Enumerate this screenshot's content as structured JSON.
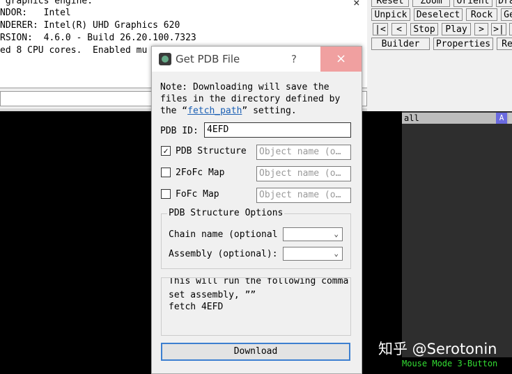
{
  "console": {
    "lines": [
      " graphics engine:",
      "NDOR:   Intel",
      "NDERER: Intel(R) UHD Graphics 620",
      "RSION:  4.6.0 - Build 26.20.100.7323",
      "ed 8 CPU cores.  Enabled mu"
    ],
    "close_glyph": "×"
  },
  "button_panel": {
    "row0": [
      "Reset",
      "Zoom",
      "Orient",
      "Dra"
    ],
    "row1": [
      "Unpick",
      "Deselect",
      "Rock",
      "Ge"
    ],
    "row2": [
      "|<",
      "<",
      "Stop",
      "Play",
      ">",
      ">|",
      "M"
    ],
    "row3": [
      "Builder",
      "Properties",
      "Re"
    ]
  },
  "object_panel": {
    "name": "all",
    "badge": "A",
    "mouse_mode": "Mouse Mode 3-Button"
  },
  "watermark": "知乎 @Serotonin",
  "dialog": {
    "title": "Get PDB File",
    "help": "?",
    "close": "×",
    "note_line1": "Note: Downloading will save the",
    "note_line2": "files in the directory defined by",
    "note_line3_pre": "the “",
    "note_link": "fetch_path",
    "note_line3_post": "” setting.",
    "pdb_id_label": "PDB ID:",
    "pdb_id_value": "4EFD",
    "rows": [
      {
        "label": "PDB Structure",
        "checked": true,
        "check_glyph": "✓",
        "placeholder": "Object name (o…"
      },
      {
        "label": "2FoFc Map",
        "checked": false,
        "check_glyph": "",
        "placeholder": "Object name (o…"
      },
      {
        "label": "FoFc Map",
        "checked": false,
        "check_glyph": "",
        "placeholder": "Object name (o…"
      }
    ],
    "options_title": "PDB Structure Options",
    "chain_label": "Chain name (optional",
    "assembly_label": "Assembly (optional):",
    "chain_value": "",
    "assembly_value": "",
    "chevron": "⌄",
    "script_line1": "This will run the following comma",
    "script_line2": "set assembly, ””",
    "script_line3": "fetch 4EFD",
    "download_label": "Download"
  }
}
